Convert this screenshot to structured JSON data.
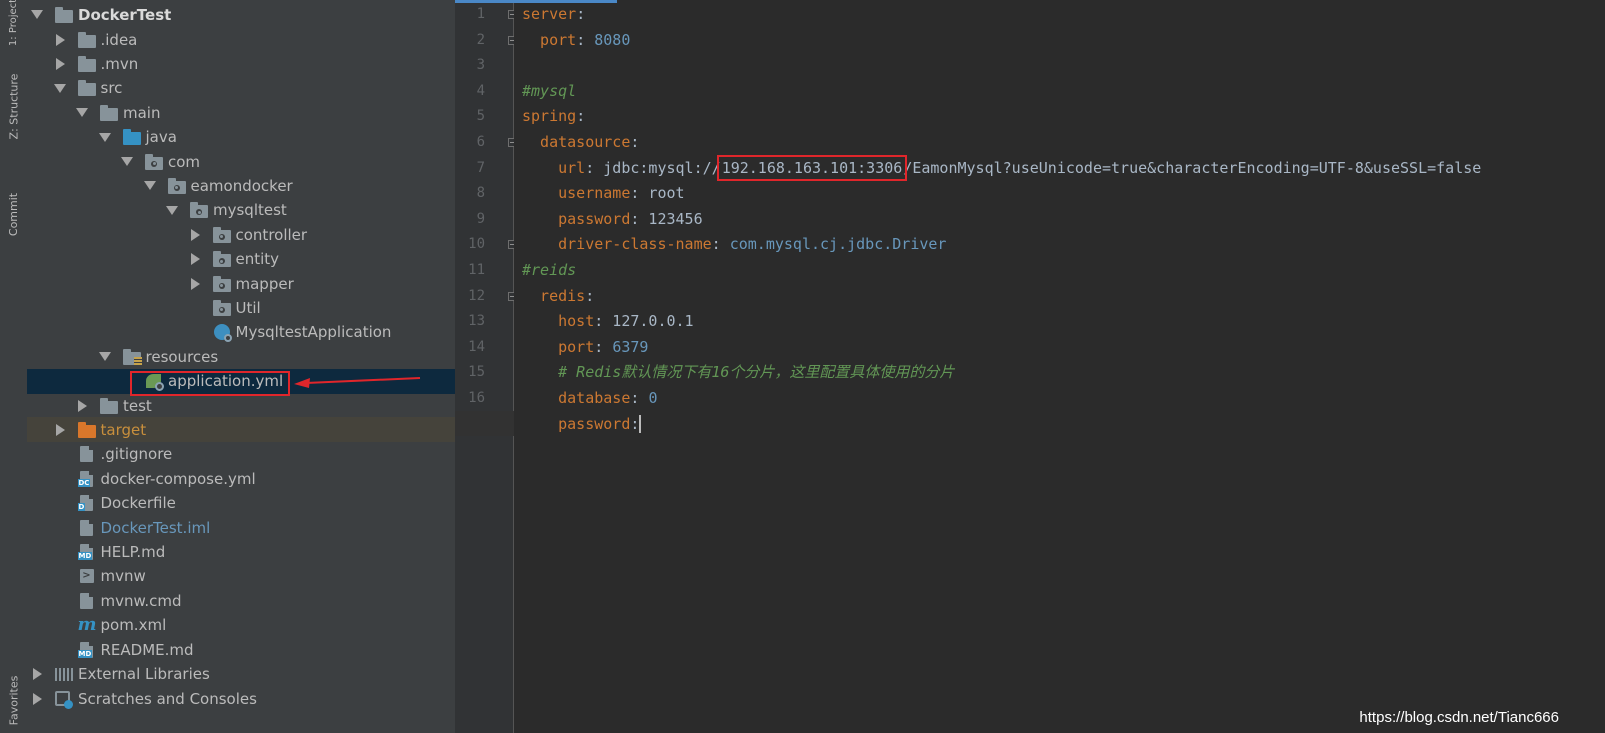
{
  "tool_strip": {
    "tabs": [
      "1: Project",
      "Z: Structure",
      "Commit",
      "Favorites"
    ]
  },
  "project_tree": {
    "root": "DockerTest",
    "items": [
      {
        "label": ".idea",
        "depth": 1,
        "arrow": "closed",
        "icon": "folder"
      },
      {
        "label": ".mvn",
        "depth": 1,
        "arrow": "closed",
        "icon": "folder"
      },
      {
        "label": "src",
        "depth": 1,
        "arrow": "open",
        "icon": "folder"
      },
      {
        "label": "main",
        "depth": 2,
        "arrow": "open",
        "icon": "folder"
      },
      {
        "label": "java",
        "depth": 3,
        "arrow": "open",
        "icon": "folder-blue"
      },
      {
        "label": "com",
        "depth": 4,
        "arrow": "open",
        "icon": "package"
      },
      {
        "label": "eamondocker",
        "depth": 5,
        "arrow": "open",
        "icon": "package"
      },
      {
        "label": "mysqltest",
        "depth": 6,
        "arrow": "open",
        "icon": "package"
      },
      {
        "label": "controller",
        "depth": 7,
        "arrow": "closed",
        "icon": "package"
      },
      {
        "label": "entity",
        "depth": 7,
        "arrow": "closed",
        "icon": "package"
      },
      {
        "label": "mapper",
        "depth": 7,
        "arrow": "closed",
        "icon": "package"
      },
      {
        "label": "Util",
        "depth": 7,
        "arrow": "none",
        "icon": "package"
      },
      {
        "label": "MysqltestApplication",
        "depth": 7,
        "arrow": "none",
        "icon": "app"
      },
      {
        "label": "resources",
        "depth": 3,
        "arrow": "open",
        "icon": "resources"
      },
      {
        "label": "application.yml",
        "depth": 4,
        "arrow": "none",
        "icon": "spring",
        "selected": true
      },
      {
        "label": "test",
        "depth": 2,
        "arrow": "closed",
        "icon": "folder"
      },
      {
        "label": "target",
        "depth": 1,
        "arrow": "closed",
        "icon": "folder-orange",
        "excluded": true
      },
      {
        "label": ".gitignore",
        "depth": 1,
        "arrow": "none",
        "icon": "file"
      },
      {
        "label": "docker-compose.yml",
        "depth": 1,
        "arrow": "none",
        "icon": "file-dc"
      },
      {
        "label": "Dockerfile",
        "depth": 1,
        "arrow": "none",
        "icon": "file-d"
      },
      {
        "label": "DockerTest.iml",
        "depth": 1,
        "arrow": "none",
        "icon": "file-iml"
      },
      {
        "label": "HELP.md",
        "depth": 1,
        "arrow": "none",
        "icon": "file-md"
      },
      {
        "label": "mvnw",
        "depth": 1,
        "arrow": "none",
        "icon": "terminal"
      },
      {
        "label": "mvnw.cmd",
        "depth": 1,
        "arrow": "none",
        "icon": "file"
      },
      {
        "label": "pom.xml",
        "depth": 1,
        "arrow": "none",
        "icon": "maven"
      },
      {
        "label": "README.md",
        "depth": 1,
        "arrow": "none",
        "icon": "file-md"
      }
    ],
    "external_libraries": "External Libraries",
    "scratches": "Scratches and Consoles"
  },
  "editor": {
    "current_line": 17,
    "lines": [
      [
        {
          "t": "server",
          "c": "k"
        },
        {
          "t": ":",
          "c": ""
        }
      ],
      [
        {
          "t": "  port",
          "c": "k"
        },
        {
          "t": ": ",
          "c": ""
        },
        {
          "t": "8080",
          "c": "n"
        }
      ],
      [],
      [
        {
          "t": "#mysql",
          "c": "c"
        }
      ],
      [
        {
          "t": "spring",
          "c": "k"
        },
        {
          "t": ":",
          "c": ""
        }
      ],
      [
        {
          "t": "  datasource",
          "c": "k"
        },
        {
          "t": ":",
          "c": ""
        }
      ],
      [
        {
          "t": "    url",
          "c": "k"
        },
        {
          "t": ": jdbc:mysql://",
          "c": ""
        },
        {
          "t": "192.168.163.101:3306",
          "c": "",
          "box": true
        },
        {
          "t": "/EamonMysql?useUnicode=true&characterEncoding=UTF-8&useSSL=false",
          "c": ""
        }
      ],
      [
        {
          "t": "    username",
          "c": "k"
        },
        {
          "t": ": root",
          "c": ""
        }
      ],
      [
        {
          "t": "    password",
          "c": "k"
        },
        {
          "t": ": 123456",
          "c": ""
        }
      ],
      [
        {
          "t": "    driver-class-name",
          "c": "k"
        },
        {
          "t": ": ",
          "c": ""
        },
        {
          "t": "com.mysql.cj.jdbc.Driver",
          "c": "n"
        }
      ],
      [
        {
          "t": "#reids",
          "c": "c"
        }
      ],
      [
        {
          "t": "  redis",
          "c": "k"
        },
        {
          "t": ":",
          "c": ""
        }
      ],
      [
        {
          "t": "    host",
          "c": "k"
        },
        {
          "t": ": 127.0.0.1",
          "c": ""
        }
      ],
      [
        {
          "t": "    port",
          "c": "k"
        },
        {
          "t": ": ",
          "c": ""
        },
        {
          "t": "6379",
          "c": "n"
        }
      ],
      [
        {
          "t": "    # Redis默认情况下有16个分片，这里配置具体使用的分片",
          "c": "c"
        }
      ],
      [
        {
          "t": "    database",
          "c": "k"
        },
        {
          "t": ": ",
          "c": ""
        },
        {
          "t": "0",
          "c": "n"
        }
      ],
      [
        {
          "t": "    password",
          "c": "k"
        },
        {
          "t": ":",
          "c": ""
        }
      ]
    ],
    "fold_lines": [
      1,
      2,
      6,
      10,
      12,
      17
    ]
  },
  "watermark": "https://blog.csdn.net/Tianc666",
  "colors": {
    "highlight": "#e0262b",
    "selection": "#0d293e",
    "keyword": "#cc7832",
    "number": "#6897bb",
    "comment": "#629755"
  }
}
